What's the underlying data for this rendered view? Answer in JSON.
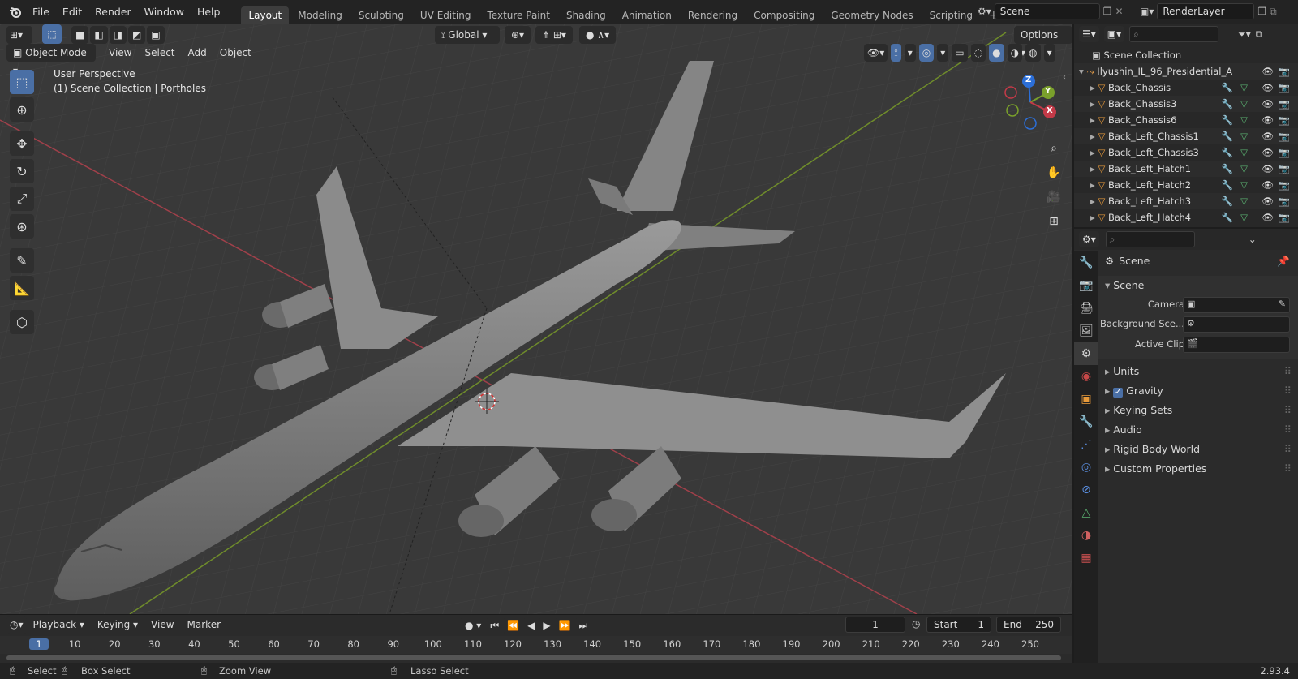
{
  "topbar": {
    "menus": [
      "File",
      "Edit",
      "Render",
      "Window",
      "Help"
    ],
    "workspaces": [
      "Layout",
      "Modeling",
      "Sculpting",
      "UV Editing",
      "Texture Paint",
      "Shading",
      "Animation",
      "Rendering",
      "Compositing",
      "Geometry Nodes",
      "Scripting"
    ],
    "active_workspace": "Layout",
    "scene_name": "Scene",
    "view_layer": "RenderLayer"
  },
  "viewport": {
    "transform_orientation": "Global",
    "options_label": "Options",
    "mode": "Object Mode",
    "menus": [
      "View",
      "Select",
      "Add",
      "Object"
    ],
    "overlay_title": "User Perspective",
    "overlay_subtitle": "(1) Scene Collection | Portholes",
    "gizmo": {
      "z": "Z",
      "y": "Y",
      "x": "X"
    }
  },
  "timeline": {
    "menus": [
      "Playback",
      "Keying",
      "View",
      "Marker"
    ],
    "current_frame": "1",
    "start_label": "Start",
    "start": "1",
    "end_label": "End",
    "end": "250",
    "ticks": [
      "1",
      "10",
      "20",
      "30",
      "40",
      "50",
      "60",
      "70",
      "80",
      "90",
      "100",
      "110",
      "120",
      "130",
      "140",
      "150",
      "160",
      "170",
      "180",
      "190",
      "200",
      "210",
      "220",
      "230",
      "240",
      "250"
    ]
  },
  "statusbar": {
    "select": "Select",
    "box_select": "Box Select",
    "zoom_view": "Zoom View",
    "lasso_select": "Lasso Select",
    "version": "2.93.4"
  },
  "outliner": {
    "root": "Scene Collection",
    "collection": "Ilyushin_IL_96_Presidential_A",
    "items": [
      "Back_Chassis",
      "Back_Chassis3",
      "Back_Chassis6",
      "Back_Left_Chassis1",
      "Back_Left_Chassis3",
      "Back_Left_Hatch1",
      "Back_Left_Hatch2",
      "Back_Left_Hatch3",
      "Back_Left_Hatch4"
    ]
  },
  "properties": {
    "context": "Scene",
    "panel_title": "Scene",
    "camera_label": "Camera",
    "background_label": "Background Sce...",
    "active_clip_label": "Active Clip",
    "subpanels": [
      "Units",
      "Gravity",
      "Keying Sets",
      "Audio",
      "Rigid Body World",
      "Custom Properties"
    ],
    "gravity_checked": true
  },
  "colors": {
    "accent": "#4a6fa5",
    "x_axis": "#c33a48",
    "y_axis": "#7aa02b",
    "z_axis": "#2c6fd8"
  }
}
